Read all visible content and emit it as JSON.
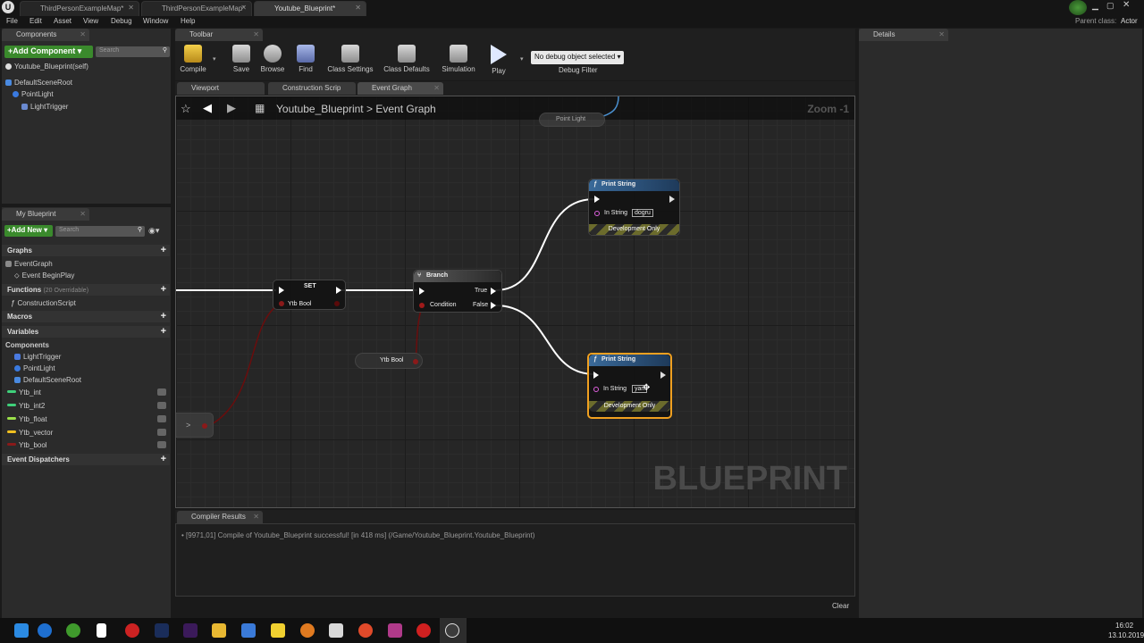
{
  "window": {
    "tabs": [
      "ThirdPersonExampleMap*",
      "ThirdPersonExampleMap*",
      "Youtube_Blueprint*"
    ],
    "parent_class_label": "Parent class:",
    "parent_class_value": "Actor"
  },
  "menu": [
    "File",
    "Edit",
    "Asset",
    "View",
    "Debug",
    "Window",
    "Help"
  ],
  "components_panel": {
    "tab": "Components",
    "add_button": "+Add Component",
    "search_placeholder": "Search",
    "self_item": "Youtube_Blueprint(self)",
    "tree": [
      "DefaultSceneRoot",
      "PointLight",
      "LightTrigger"
    ]
  },
  "my_blueprint": {
    "tab": "My Blueprint",
    "add_new": "+Add New",
    "search_placeholder": "Search",
    "graphs_header": "Graphs",
    "graph_items": [
      "EventGraph",
      "Event BeginPlay"
    ],
    "functions_header": "Functions",
    "functions_note": "(20 Overridable)",
    "function_items": [
      "ConstructionScript"
    ],
    "macros_header": "Macros",
    "variables_header": "Variables",
    "components_subheader": "Components",
    "component_vars": [
      "LightTrigger",
      "PointLight",
      "DefaultSceneRoot"
    ],
    "variables": [
      {
        "name": "Ytb_int",
        "color": "#3fd07a"
      },
      {
        "name": "Ytb_int2",
        "color": "#3fd07a"
      },
      {
        "name": "Ytb_float",
        "color": "#9be04a"
      },
      {
        "name": "Ytb_vector",
        "color": "#f0c020"
      },
      {
        "name": "Ytb_bool",
        "color": "#8a1a1a"
      }
    ],
    "dispatchers_header": "Event Dispatchers"
  },
  "toolbar": {
    "tab": "Toolbar",
    "buttons": [
      "Compile",
      "Save",
      "Browse",
      "Find",
      "Class Settings",
      "Class Defaults",
      "Simulation",
      "Play"
    ],
    "debug_select": "No debug object selected",
    "debug_label": "Debug Filter"
  },
  "editor_tabs": [
    "Viewport",
    "Construction Scrip",
    "Event Graph"
  ],
  "graph": {
    "breadcrumb_root": "Youtube_Blueprint",
    "breadcrumb_sep": ">",
    "breadcrumb_current": "Event Graph",
    "zoom": "Zoom -1",
    "watermark": "BLUEPRINT",
    "nodes": {
      "point_light": "Point Light",
      "print_string": "Print String",
      "in_string": "In String",
      "value_true": "dogru",
      "value_false": "yan",
      "dev_only": "Development Only",
      "set": "SET",
      "ytb_bool": "Ytb Bool",
      "branch": "Branch",
      "branch_true": "True",
      "branch_false": "False",
      "branch_condition": "Condition",
      "reroute": ">"
    }
  },
  "details": {
    "tab": "Details"
  },
  "output": {
    "tab": "Compiler Results",
    "message": "[9971,01] Compile of Youtube_Blueprint successful! [in 418 ms] (/Game/Youtube_Blueprint.Youtube_Blueprint)",
    "clear": "Clear"
  },
  "taskbar": {
    "time": "16:02",
    "date": "13.10.2019",
    "icons": [
      "windows-icon",
      "edge-icon",
      "app-icon",
      "file-icon",
      "record-icon",
      "photoshop-icon",
      "premiere-icon",
      "explorer-icon",
      "monitor-icon",
      "notes-icon",
      "blender-icon",
      "paint-icon",
      "chrome-icon",
      "mixer-icon",
      "opera-icon",
      "unreal-icon"
    ],
    "icon_colors": [
      "#2b8ae2",
      "#1e6fd0",
      "#3f9a2c",
      "#ffffff",
      "#cc2222",
      "#1a2d5a",
      "#3b1a5a",
      "#e8b832",
      "#3a7ad8",
      "#f0d030",
      "#e07a20",
      "#d8d8d8",
      "#e04a2a",
      "#b03a8a",
      "#d02020",
      "#222222"
    ]
  }
}
